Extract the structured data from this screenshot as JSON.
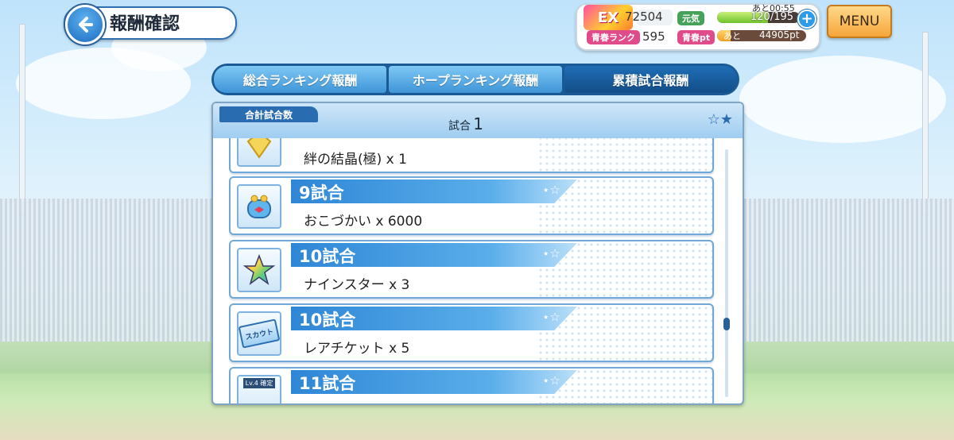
{
  "header": {
    "title": "報酬確認"
  },
  "status": {
    "logo_text": "EX",
    "coins": "72504",
    "energy_label": "元気",
    "energy_timer": "あと00:55",
    "energy_value": "120/195",
    "energy_fraction": 0.615,
    "rank_label": "青春ランク",
    "rank_value": "595",
    "pt_label": "青春pt",
    "pt_prefix": "あと",
    "pt_value": "44905pt",
    "pt_fraction": 0.15,
    "menu_label": "MENU"
  },
  "tabs": [
    {
      "label": "総合ランキング報酬",
      "active": false
    },
    {
      "label": "ホープランキング報酬",
      "active": false
    },
    {
      "label": "累積試合報酬",
      "active": true
    }
  ],
  "summary": {
    "label": "合計試合数",
    "value": "1",
    "unit": "試合"
  },
  "rewards": [
    {
      "title": "",
      "item": "絆の結晶(極) x 1",
      "icon": "crystal-icon"
    },
    {
      "title": "9試合",
      "item": "おこづかい x 6000",
      "icon": "coin-purse-icon"
    },
    {
      "title": "10試合",
      "item": "ナインスター x 3",
      "icon": "rainbow-star-icon"
    },
    {
      "title": "10試合",
      "item": "レアチケット x 5",
      "icon": "scout-ticket-icon"
    },
    {
      "title": "11試合",
      "item": "",
      "icon": "level-item-icon",
      "badge": "Lv.4 確定"
    }
  ],
  "ticket_text": "スカウト"
}
